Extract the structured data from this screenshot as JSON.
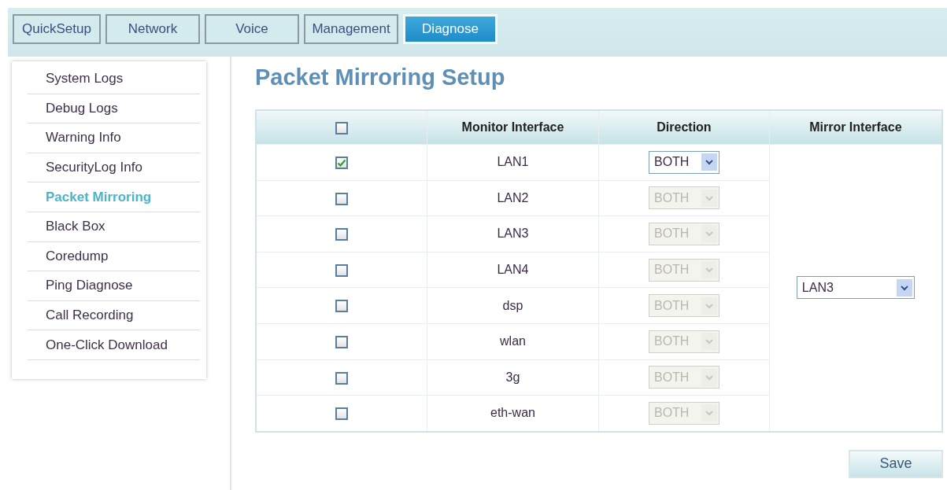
{
  "tabs": [
    {
      "label": "QuickSetup",
      "selected": false
    },
    {
      "label": "Network",
      "selected": false
    },
    {
      "label": "Voice",
      "selected": false
    },
    {
      "label": "Management",
      "selected": false
    },
    {
      "label": "Diagnose",
      "selected": true
    }
  ],
  "sidebar": {
    "items": [
      {
        "label": "System Logs",
        "selected": false
      },
      {
        "label": "Debug Logs",
        "selected": false
      },
      {
        "label": "Warning Info",
        "selected": false
      },
      {
        "label": "SecurityLog Info",
        "selected": false
      },
      {
        "label": "Packet Mirroring",
        "selected": true
      },
      {
        "label": "Black Box",
        "selected": false
      },
      {
        "label": "Coredump",
        "selected": false
      },
      {
        "label": "Ping Diagnose",
        "selected": false
      },
      {
        "label": "Call Recording",
        "selected": false
      },
      {
        "label": "One-Click Download",
        "selected": false
      }
    ]
  },
  "page_title": "Packet Mirroring Setup",
  "table": {
    "select_all_checked": false,
    "columns": [
      "Monitor Interface",
      "Direction",
      "Mirror Interface"
    ],
    "rows": [
      {
        "checked": true,
        "monitor_interface": "LAN1",
        "direction": "BOTH",
        "direction_disabled": false
      },
      {
        "checked": false,
        "monitor_interface": "LAN2",
        "direction": "BOTH",
        "direction_disabled": true
      },
      {
        "checked": false,
        "monitor_interface": "LAN3",
        "direction": "BOTH",
        "direction_disabled": true
      },
      {
        "checked": false,
        "monitor_interface": "LAN4",
        "direction": "BOTH",
        "direction_disabled": true
      },
      {
        "checked": false,
        "monitor_interface": "dsp",
        "direction": "BOTH",
        "direction_disabled": true
      },
      {
        "checked": false,
        "monitor_interface": "wlan",
        "direction": "BOTH",
        "direction_disabled": true
      },
      {
        "checked": false,
        "monitor_interface": "3g",
        "direction": "BOTH",
        "direction_disabled": true
      },
      {
        "checked": false,
        "monitor_interface": "eth-wan",
        "direction": "BOTH",
        "direction_disabled": true
      }
    ],
    "mirror_interface": "LAN3"
  },
  "buttons": [
    "Save"
  ]
}
